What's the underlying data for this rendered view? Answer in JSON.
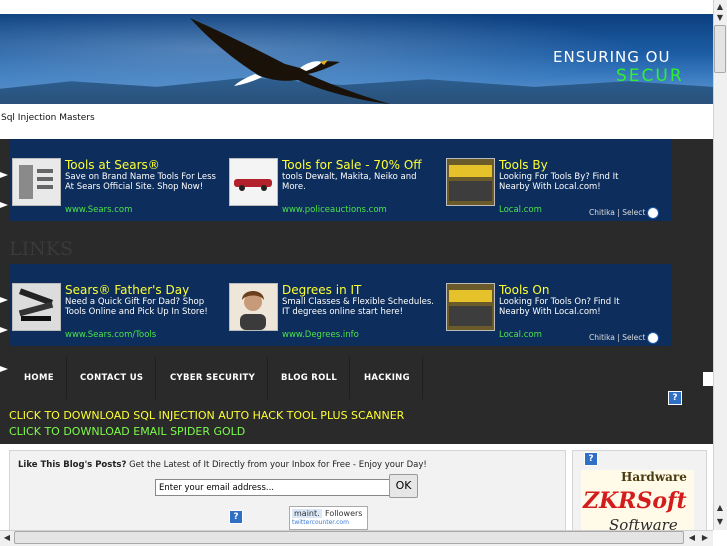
{
  "banner": {
    "line1": "ENSURING OU",
    "line2": "SECUR"
  },
  "site_subtitle": "Sql Injection Masters",
  "ads_top": [
    {
      "title": "Tools at Sears®",
      "desc": "Save on Brand Name Tools For Less At Sears Official Site. Shop Now!",
      "url": "www.Sears.com"
    },
    {
      "title": "Tools for Sale - 70% Off",
      "desc": "tools Dewalt, Makita, Neiko and More.",
      "url": "www.policeauctions.com"
    },
    {
      "title": "Tools By",
      "desc": "Looking For Tools By? Find It Nearby With Local.com!",
      "url": "Local.com"
    }
  ],
  "ads_bottom": [
    {
      "title": "Sears® Father's Day",
      "desc": "Need a Quick Gift For Dad? Shop Tools Online and Pick Up In Store!",
      "url": "www.Sears.com/Tools"
    },
    {
      "title": "Degrees in IT",
      "desc": "Small Classes & Flexible Schedules. IT degrees online start here!",
      "url": "www.Degrees.info"
    },
    {
      "title": "Tools On",
      "desc": "Looking For Tools On? Find It Nearby With Local.com!",
      "url": "Local.com"
    }
  ],
  "chitika_label": "Chitika | Select",
  "links_heading": "LINKS",
  "nav": [
    "HOME",
    "CONTACT US",
    "CYBER SECURITY",
    "BLOG ROLL",
    "HACKING"
  ],
  "downloads": {
    "line1": "CLICK TO DOWNLOAD SQL INJECTION AUTO HACK TOOL PLUS SCANNER",
    "line2": "CLICK TO DOWNLOAD EMAIL SPIDER GOLD"
  },
  "subscribe": {
    "bold": "Like This Blog's Posts?",
    "rest": " Get the Latest of It Directly from your Inbox for Free - Enjoy your Day!",
    "placeholder": "Enter your email address...",
    "ok": "OK"
  },
  "twitter": {
    "maint": "maint.",
    "followers": "Followers",
    "brand": "twittercounter.com"
  },
  "help_glyph": "?",
  "zkr": {
    "top": "Hardware",
    "main": "ZKRSoft",
    "bottom": "Software"
  },
  "colors": {
    "ad_background": "#0d2e5c",
    "ad_title": "#ffff33",
    "ad_url": "#4be34b",
    "dark_area": "#2a2a2a",
    "download_line1": "#ffff33",
    "download_line2": "#7dfc4a",
    "banner_secure": "#2ef031"
  },
  "icons": {
    "scroll_up": "arrow-up-icon",
    "scroll_down": "arrow-down-icon",
    "scroll_left": "arrow-left-icon",
    "scroll_right": "arrow-right-icon",
    "help": "question-icon",
    "search": "magnifier-icon"
  }
}
